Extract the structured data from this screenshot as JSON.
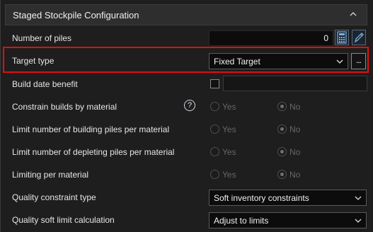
{
  "section": {
    "title": "Staged Stockpile Configuration"
  },
  "number_of_piles": {
    "label": "Number of piles",
    "value": "0"
  },
  "target_type": {
    "label": "Target type",
    "value": "Fixed Target",
    "more_button": "..."
  },
  "build_date_benefit": {
    "label": "Build date benefit",
    "checked": false
  },
  "radio_rows": [
    {
      "label": "Constrain builds by material",
      "yes": "Yes",
      "no": "No",
      "selected": "No"
    },
    {
      "label": "Limit number of building piles per material",
      "yes": "Yes",
      "no": "No",
      "selected": "No"
    },
    {
      "label": "Limit number of depleting piles per material",
      "yes": "Yes",
      "no": "No",
      "selected": "No"
    },
    {
      "label": "Limiting per material",
      "yes": "Yes",
      "no": "No",
      "selected": "No"
    }
  ],
  "help_icon": "?",
  "quality_constraint_type": {
    "label": "Quality constraint type",
    "value": "Soft inventory constraints"
  },
  "quality_soft_limit": {
    "label": "Quality soft limit calculation",
    "value": "Adjust to limits"
  },
  "colors": {
    "background": "#1e1e1e",
    "highlight": "#e01010",
    "input_bg": "#0c0c0c"
  }
}
